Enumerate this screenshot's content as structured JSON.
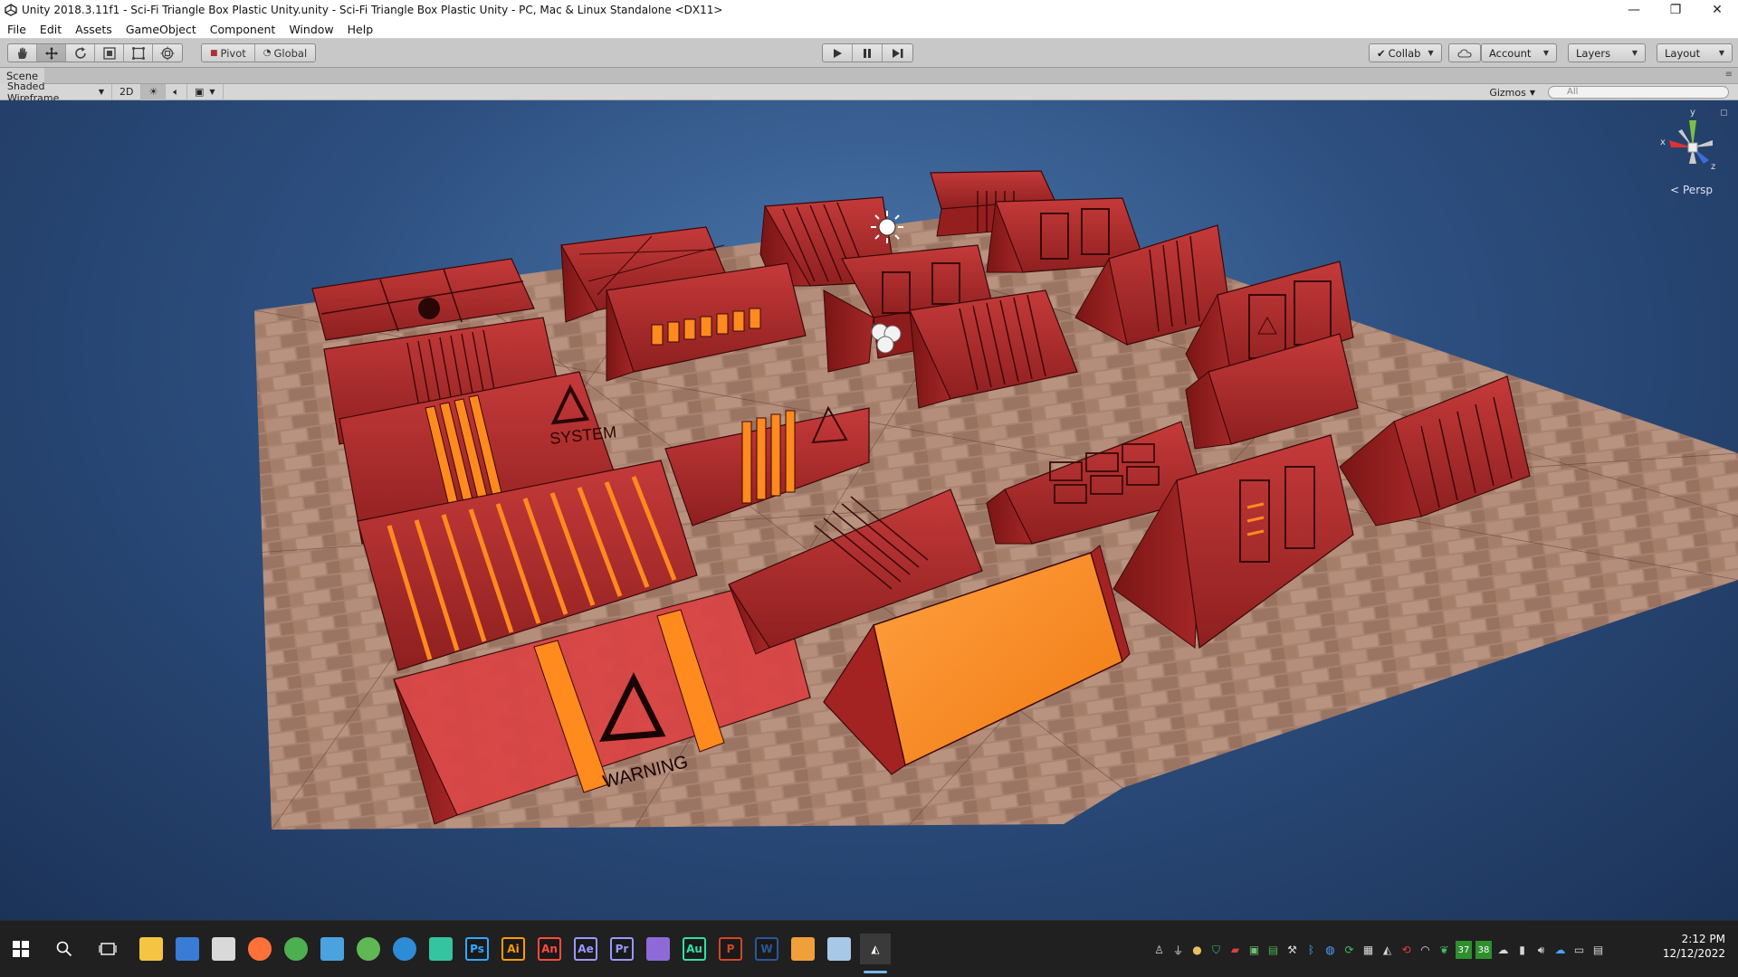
{
  "window": {
    "title": "Unity 2018.3.11f1 - Sci-Fi Triangle Box Plastic Unity.unity - Sci-Fi Triangle Box Plastic Unity - PC, Mac & Linux Standalone <DX11>",
    "controls": {
      "minimize": "—",
      "maximize": "❐",
      "close": "✕"
    }
  },
  "menu": [
    "File",
    "Edit",
    "Assets",
    "GameObject",
    "Component",
    "Window",
    "Help"
  ],
  "toolbar": {
    "tools": [
      "hand-tool",
      "move-tool",
      "rotate-tool",
      "scale-tool",
      "rect-tool",
      "transform-tool"
    ],
    "pivot_label": "Pivot",
    "global_label": "Global",
    "play_controls": [
      "play",
      "pause",
      "step"
    ],
    "collab_label": "Collab",
    "account_label": "Account",
    "layers_label": "Layers",
    "layout_label": "Layout"
  },
  "scene": {
    "tab_label": "Scene",
    "shading_mode": "Shaded Wireframe",
    "mode_2d": "2D",
    "gizmos_label": "Gizmos",
    "search_placeholder": "All",
    "persp_label": "Persp",
    "axes": {
      "y": "y",
      "x": "x",
      "z": "z"
    },
    "labels": {
      "system": "SYSTEM",
      "warning": "WARNING"
    },
    "colors": {
      "sky_top": "#1c3358",
      "sky_mid": "#4c78ad",
      "prop_red": "#b02828",
      "prop_orange": "#ff8a1e",
      "floor": "#b58d7a"
    }
  },
  "taskbar": {
    "apps": [
      {
        "name": "file-explorer-icon",
        "glyph": "",
        "color": "#f5c542"
      },
      {
        "name": "app-blue-icon",
        "glyph": "",
        "color": "#3a7bd5"
      },
      {
        "name": "paint-icon",
        "glyph": "",
        "color": "#d9d9d9"
      },
      {
        "name": "firefox-icon",
        "glyph": "",
        "color": "#ff7139"
      },
      {
        "name": "chrome-icon",
        "glyph": "",
        "color": "#4caf50"
      },
      {
        "name": "search-app-icon",
        "glyph": "",
        "color": "#4aa3df"
      },
      {
        "name": "globe-icon",
        "glyph": "",
        "color": "#5fb854"
      },
      {
        "name": "earth-icon",
        "glyph": "",
        "color": "#2e8bd6"
      },
      {
        "name": "dreamweaver-icon",
        "glyph": "",
        "color": "#35c4a0"
      },
      {
        "name": "photoshop-icon",
        "glyph": "Ps",
        "color": "#31a8ff"
      },
      {
        "name": "illustrator-icon",
        "glyph": "Ai",
        "color": "#ff9a00"
      },
      {
        "name": "animate-icon",
        "glyph": "An",
        "color": "#ff4b3a"
      },
      {
        "name": "after-effects-icon",
        "glyph": "Ae",
        "color": "#9999ff"
      },
      {
        "name": "premiere-icon",
        "glyph": "Pr",
        "color": "#9999ff"
      },
      {
        "name": "visual-studio-icon",
        "glyph": "",
        "color": "#8e6ad8"
      },
      {
        "name": "audition-icon",
        "glyph": "Au",
        "color": "#2fe0a8"
      },
      {
        "name": "powerpoint-icon",
        "glyph": "P",
        "color": "#d24726"
      },
      {
        "name": "word-icon",
        "glyph": "W",
        "color": "#2b579a"
      },
      {
        "name": "sublime-icon",
        "glyph": "",
        "color": "#f0a03a"
      },
      {
        "name": "notepad-icon",
        "glyph": "",
        "color": "#a8c8e8"
      },
      {
        "name": "unity-icon",
        "glyph": "",
        "color": "#ffffff"
      }
    ],
    "tray_badges": [
      "37",
      "38"
    ],
    "time": "2:12 PM",
    "date": "12/12/2022"
  }
}
